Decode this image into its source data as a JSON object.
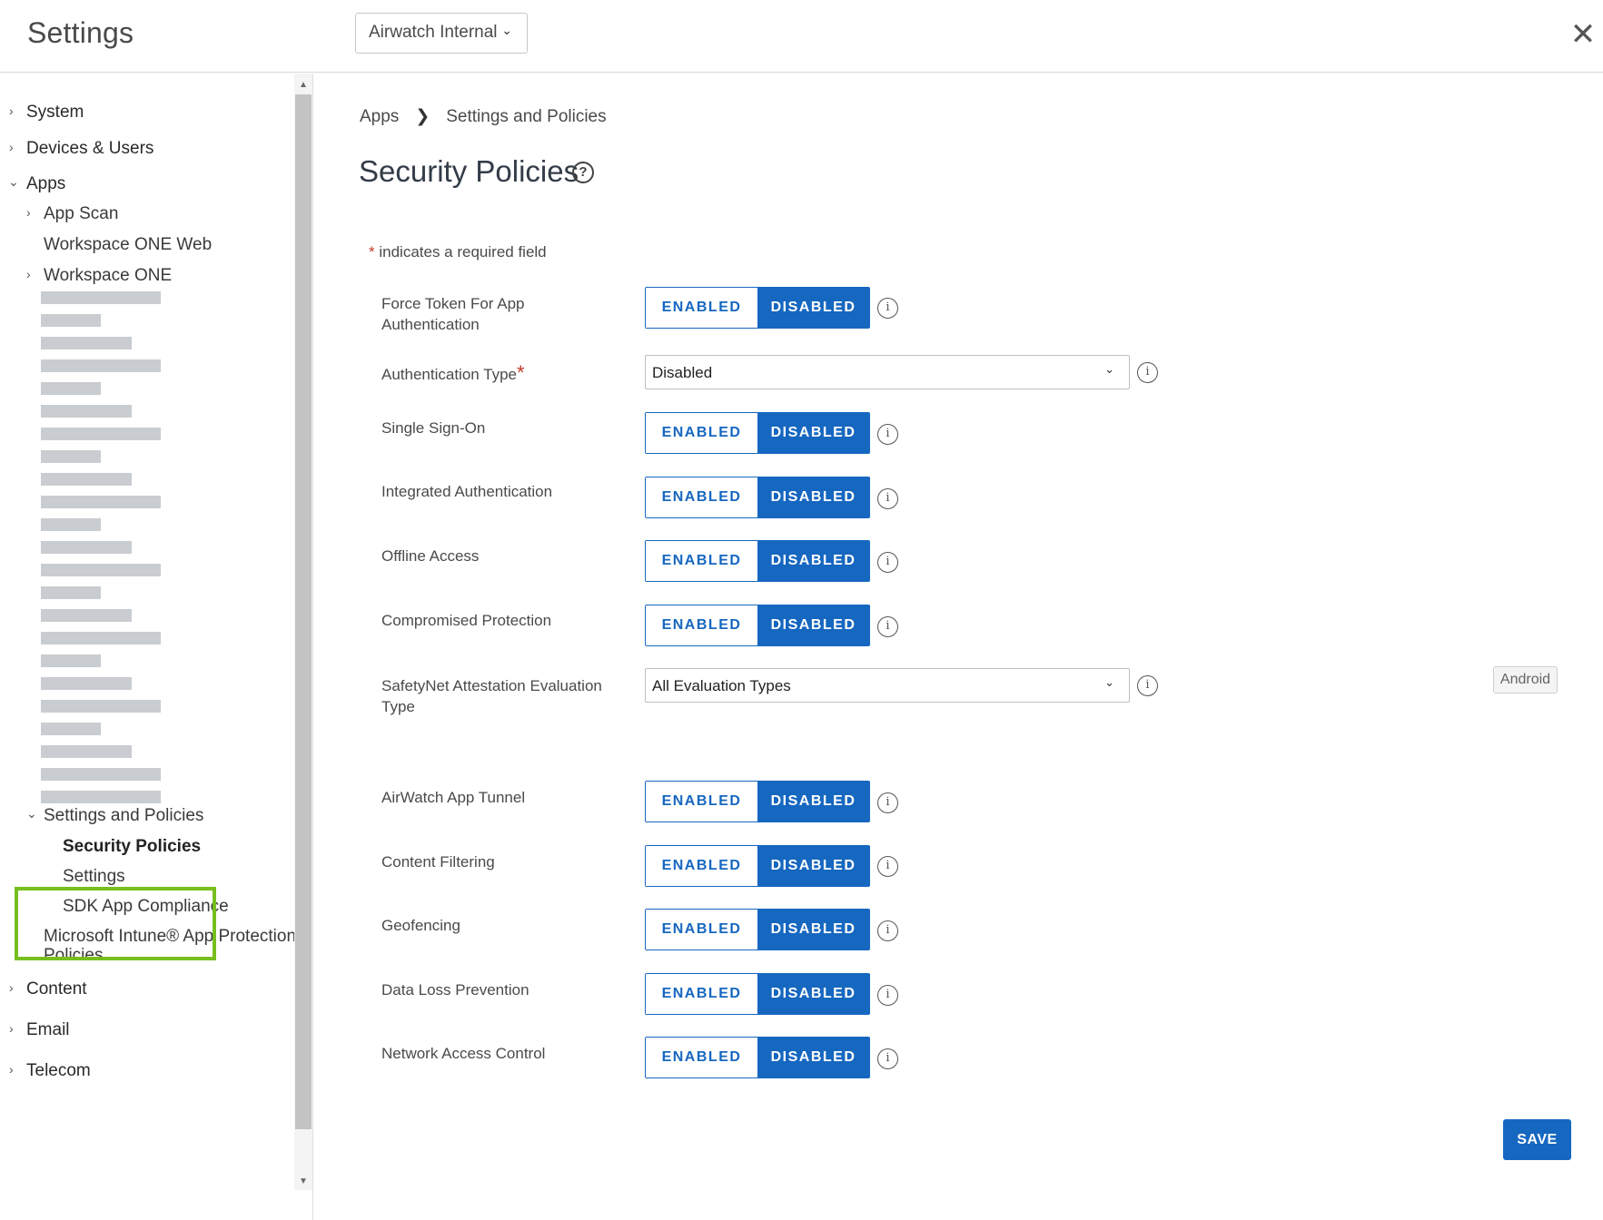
{
  "header": {
    "title": "Settings",
    "org_selector": "Airwatch Internal",
    "close_icon": "close-icon"
  },
  "sidebar": {
    "system": "System",
    "devices_users": "Devices & Users",
    "apps": "Apps",
    "app_scan": "App Scan",
    "workspace_one_web": "Workspace ONE Web",
    "workspace_one": "Workspace ONE",
    "settings_and_policies": "Settings and Policies",
    "security_policies": "Security Policies",
    "settings": "Settings",
    "sdk_app_compliance": "SDK App Compliance",
    "intune_line1": "Microsoft Intune® App Protection",
    "intune_line2": "Policies",
    "content": "Content",
    "email": "Email",
    "telecom": "Telecom",
    "highlight_color": "#77be1f"
  },
  "breadcrumb": {
    "apps": "Apps",
    "separator": "❯",
    "current": "Settings and Policies"
  },
  "page": {
    "title": "Security Policies",
    "help_icon": "help-circle-icon",
    "required_star": "*",
    "required_note": "indicates a required field",
    "accent_color": "#1667c0"
  },
  "toggle_labels": {
    "enabled": "ENABLED",
    "disabled": "DISABLED"
  },
  "fields": {
    "force_token": {
      "label_1": "Force Token For App",
      "label_2": "Authentication",
      "value": "DISABLED"
    },
    "auth_type": {
      "label": "Authentication Type",
      "required": "*",
      "value": "Disabled"
    },
    "sso": {
      "label": "Single Sign-On",
      "value": "DISABLED"
    },
    "integrated_auth": {
      "label": "Integrated Authentication",
      "value": "DISABLED"
    },
    "offline_access": {
      "label": "Offline Access",
      "value": "DISABLED"
    },
    "compromised_protection": {
      "label": "Compromised Protection",
      "value": "DISABLED"
    },
    "safetynet": {
      "label_1": "SafetyNet Attestation Evaluation",
      "label_2": "Type",
      "value": "All Evaluation Types",
      "badge": "Android"
    },
    "app_tunnel": {
      "label": "AirWatch App Tunnel",
      "value": "DISABLED"
    },
    "content_filtering": {
      "label": "Content Filtering",
      "value": "DISABLED"
    },
    "geofencing": {
      "label": "Geofencing",
      "value": "DISABLED"
    },
    "dlp": {
      "label": "Data Loss Prevention",
      "value": "DISABLED"
    },
    "nac": {
      "label": "Network Access Control",
      "value": "DISABLED"
    }
  },
  "info_glyph": "i",
  "save_label": "SAVE"
}
